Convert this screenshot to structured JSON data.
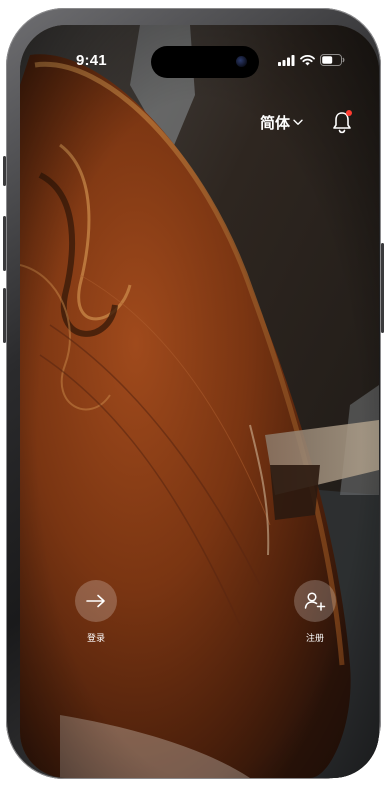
{
  "status_bar": {
    "time": "9:41"
  },
  "header": {
    "language_label": "简体",
    "notification_badge": true
  },
  "actions": {
    "login_label": "登录",
    "register_label": "注册"
  },
  "colors": {
    "badge": "#ff3b30",
    "text": "#ffffff",
    "button_bg": "rgba(255,255,255,0.22)"
  },
  "icons": {
    "language_dropdown": "chevron-down-icon",
    "notification": "bell-icon",
    "login": "arrow-right-icon",
    "register": "add-user-icon"
  }
}
